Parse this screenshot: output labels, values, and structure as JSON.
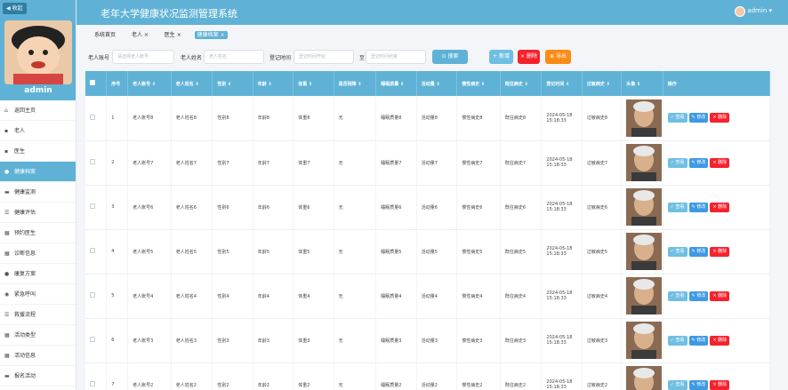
{
  "sidebar": {
    "collapse_label": "◀ 收起",
    "admin_name": "admin",
    "items": [
      {
        "label": "返回主页",
        "icon": "home-icon",
        "glyph": "⌂"
      },
      {
        "label": "老人",
        "icon": "user-icon",
        "glyph": "▪"
      },
      {
        "label": "医生",
        "icon": "doctor-icon",
        "glyph": "▪"
      },
      {
        "label": "健康档案",
        "icon": "person-icon",
        "glyph": "●",
        "active": true
      },
      {
        "label": "健康监测",
        "icon": "monitor-icon",
        "glyph": "▬"
      },
      {
        "label": "健康评估",
        "icon": "list-icon",
        "glyph": "☰"
      },
      {
        "label": "预约医生",
        "icon": "grid-icon",
        "glyph": "▦"
      },
      {
        "label": "诊断信息",
        "icon": "grid-icon",
        "glyph": "▦"
      },
      {
        "label": "康复方案",
        "icon": "pin-icon",
        "glyph": "●"
      },
      {
        "label": "紧急呼叫",
        "icon": "bell-icon",
        "glyph": "◉"
      },
      {
        "label": "救援流程",
        "icon": "list-icon",
        "glyph": "☰"
      },
      {
        "label": "活动类型",
        "icon": "grid-icon",
        "glyph": "▦"
      },
      {
        "label": "活动信息",
        "icon": "grid-icon",
        "glyph": "▦"
      },
      {
        "label": "报名活动",
        "icon": "chat-icon",
        "glyph": "▬"
      }
    ]
  },
  "header": {
    "title": "老年大学健康状况监测管理系统",
    "user": "admin ▾"
  },
  "tabs": [
    {
      "label": "系统首页",
      "active": false
    },
    {
      "label": "老人 ×",
      "active": false
    },
    {
      "label": "医生 ×",
      "active": false
    },
    {
      "label": "健康档案 ×",
      "active": true
    }
  ],
  "search": {
    "account_label": "老人账号",
    "account_placeholder": "请选择老人账号",
    "name_label": "老人姓名",
    "name_placeholder": "老人姓名",
    "date_label": "登记时间",
    "date_start_placeholder": "登记时间开始",
    "date_to": "至",
    "date_end_placeholder": "登记时间结束",
    "search_btn": "⊙ 搜索",
    "export_btn": "⊕ 导出",
    "add_btn": "+ 新增",
    "delete_btn": "× 删除"
  },
  "table": {
    "headers": [
      "序号",
      "老人账号 ⇕",
      "老人姓名 ⇕",
      "性别 ⇕",
      "年龄 ⇕",
      "体重 ⇕",
      "是否残障 ⇕",
      "睡眠质量 ⇕",
      "活动量 ⇕",
      "慢性病史 ⇕",
      "既往病史 ⇕",
      "登记时间 ⇕",
      "过敏病史 ⇕",
      "头像 ⇕",
      "操作"
    ],
    "op_view": "✓ 查看",
    "op_edit": "✎ 修改",
    "op_delete": "× 删除",
    "rows": [
      {
        "no": "1",
        "account": "老人账号8",
        "name": "老人姓名8",
        "gender": "性别8",
        "age": "年龄8",
        "weight": "体重8",
        "disabled": "无",
        "sleep": "睡眠质量8",
        "activity": "活动量8",
        "chronic": "慢性病史8",
        "history": "既往病史8",
        "date": "2024-05-18 15:18:33",
        "allergy": "过敏病史8"
      },
      {
        "no": "2",
        "account": "老人账号7",
        "name": "老人姓名7",
        "gender": "性别7",
        "age": "年龄7",
        "weight": "体重7",
        "disabled": "无",
        "sleep": "睡眠质量7",
        "activity": "活动量7",
        "chronic": "慢性病史7",
        "history": "既往病史7",
        "date": "2024-05-18 15:18:33",
        "allergy": "过敏病史7"
      },
      {
        "no": "3",
        "account": "老人账号6",
        "name": "老人姓名6",
        "gender": "性别6",
        "age": "年龄6",
        "weight": "体重6",
        "disabled": "无",
        "sleep": "睡眠质量6",
        "activity": "活动量6",
        "chronic": "慢性病史6",
        "history": "既往病史6",
        "date": "2024-05-18 15:18:33",
        "allergy": "过敏病史6"
      },
      {
        "no": "4",
        "account": "老人账号5",
        "name": "老人姓名5",
        "gender": "性别5",
        "age": "年龄5",
        "weight": "体重5",
        "disabled": "无",
        "sleep": "睡眠质量5",
        "activity": "活动量5",
        "chronic": "慢性病史5",
        "history": "既往病史5",
        "date": "2024-05-18 15:18:33",
        "allergy": "过敏病史5"
      },
      {
        "no": "5",
        "account": "老人账号4",
        "name": "老人姓名4",
        "gender": "性别4",
        "age": "年龄4",
        "weight": "体重4",
        "disabled": "无",
        "sleep": "睡眠质量4",
        "activity": "活动量4",
        "chronic": "慢性病史4",
        "history": "既往病史4",
        "date": "2024-05-18 15:18:33",
        "allergy": "过敏病史4"
      },
      {
        "no": "6",
        "account": "老人账号3",
        "name": "老人姓名3",
        "gender": "性别3",
        "age": "年龄3",
        "weight": "体重3",
        "disabled": "无",
        "sleep": "睡眠质量3",
        "activity": "活动量3",
        "chronic": "慢性病史3",
        "history": "既往病史3",
        "date": "2024-05-18 15:18:33",
        "allergy": "过敏病史3"
      },
      {
        "no": "7",
        "account": "老人账号2",
        "name": "老人姓名2",
        "gender": "性别2",
        "age": "年龄2",
        "weight": "体重2",
        "disabled": "无",
        "sleep": "睡眠质量2",
        "activity": "活动量2",
        "chronic": "慢性病史2",
        "history": "既往病史2",
        "date": "2024-05-18 15:18:33",
        "allergy": "过敏病史2"
      }
    ]
  },
  "colors": {
    "accent": "#5fb2d6",
    "danger": "#f5222d",
    "export": "#fa8c16"
  }
}
